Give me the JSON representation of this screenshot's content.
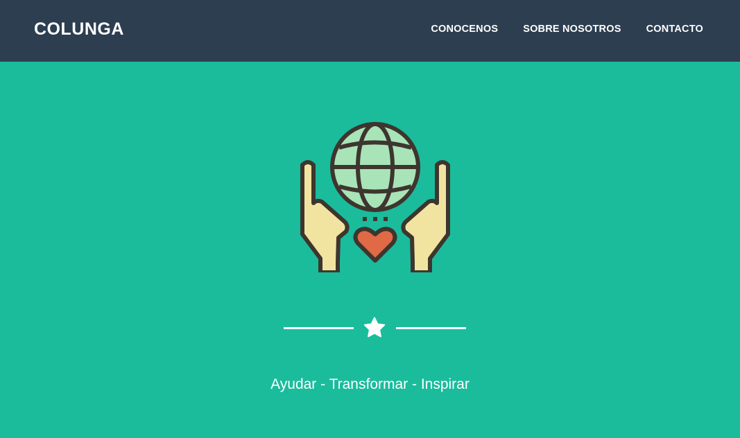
{
  "navbar": {
    "brand": "COLUNGA",
    "links": [
      "CONOCENOS",
      "SOBRE NOSOTROS",
      "CONTACTO"
    ]
  },
  "masthead": {
    "icon": "hands-holding-globe-heart-icon",
    "divider_icon": "star-icon",
    "subheading": "Ayudar - Transformar - Inspirar"
  },
  "colors": {
    "navbar_bg": "#2c3e50",
    "masthead_bg": "#1abc9c",
    "text": "#ffffff",
    "globe": "#a8e4b8",
    "hands": "#f1e4a0",
    "heart": "#e06a46",
    "outline": "#3e352e"
  }
}
